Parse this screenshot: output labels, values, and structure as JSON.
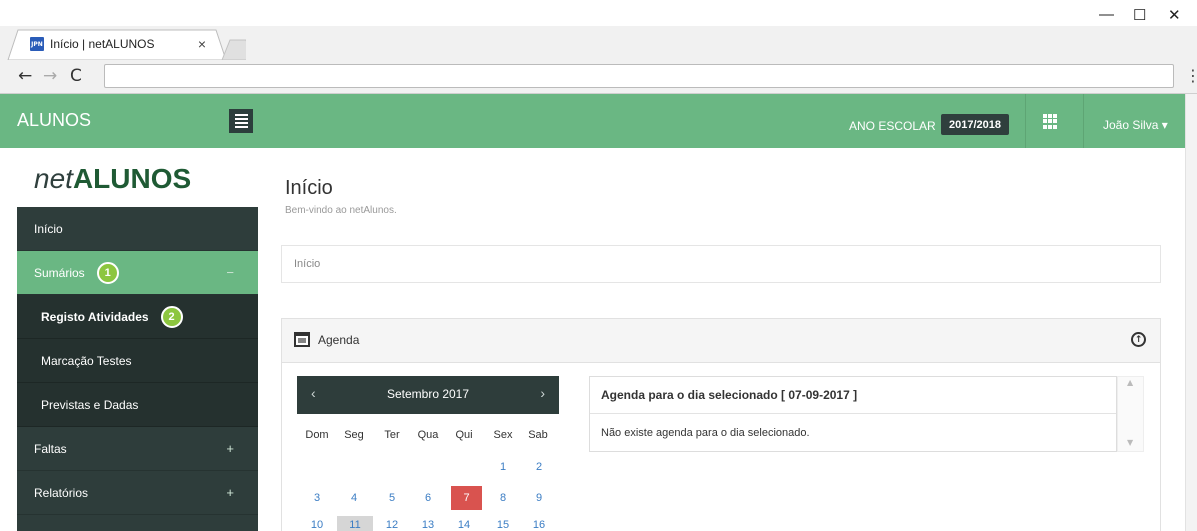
{
  "browser": {
    "tab_title": "Início | netALUNOS",
    "favicon_text": "JPN",
    "tab_close": "×",
    "back": "←",
    "forward": "→",
    "reload": "C",
    "address": "",
    "menu": "⋮",
    "minimize": "—",
    "maximize": "☐",
    "close": "✕"
  },
  "topbar": {
    "brand": "ALUNOS",
    "ano_label": "ANO ESCOLAR",
    "ano_value": "2017/2018",
    "user": "João Silva ▾"
  },
  "sidebar": {
    "logo_net": "net",
    "logo_alunos": "ALUNOS",
    "inicio": "Início",
    "sumarios": "Sumários",
    "sumarios_badge": "1",
    "sumarios_sign": "−",
    "registo": "Registo Atividades",
    "registo_badge": "2",
    "marcacao": "Marcação Testes",
    "previstas": "Previstas e Dadas",
    "faltas": "Faltas",
    "faltas_sign": "+",
    "relatorios": "Relatórios",
    "relatorios_sign": "+"
  },
  "main": {
    "title": "Início",
    "subtitle": "Bem-vindo ao netAlunos.",
    "breadcrumb": "Início",
    "panel_title": "Agenda",
    "collapse": "↑"
  },
  "calendar": {
    "month": "Setembro 2017",
    "prev": "‹",
    "next": "›",
    "weekdays": [
      "Dom",
      "Seg",
      "Ter",
      "Qua",
      "Qui",
      "Sex",
      "Sab"
    ],
    "row1": [
      "1",
      "2"
    ],
    "row2": [
      "3",
      "4",
      "5",
      "6",
      "7",
      "8",
      "9"
    ],
    "row3": [
      "10",
      "11",
      "12",
      "13",
      "14",
      "15",
      "16"
    ],
    "selected_day": "7",
    "accent_color": "#d9534f"
  },
  "agenda": {
    "header": "Agenda para o dia selecionado [ 07-09-2017 ]",
    "empty": "Não existe agenda para o dia selecionado."
  }
}
